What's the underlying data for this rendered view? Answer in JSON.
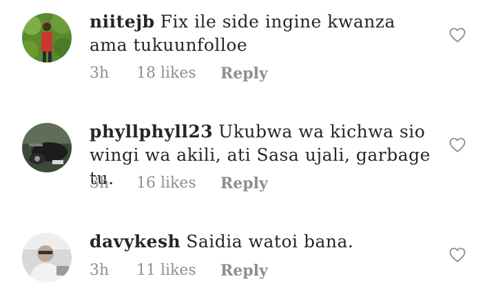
{
  "comments": [
    {
      "username": "niitejb",
      "text": "Fix ile side ingine  kwanza ama tukuunfolloe",
      "time": "3h",
      "likes": "18 likes",
      "reply": "Reply"
    },
    {
      "username": "phyllphyll23",
      "text": "Ukubwa wa kichwa sio wingi wa akili, ati Sasa ujali, garbage tu.",
      "time": "3h",
      "likes": "16 likes",
      "reply": "Reply"
    },
    {
      "username": "davykesh",
      "text": "Saidia watoi bana.",
      "time": "3h",
      "likes": "11 likes",
      "reply": "Reply"
    }
  ],
  "icons": {
    "like": "heart-outline-icon"
  },
  "colors": {
    "text": "#262626",
    "meta": "#8e8e8e"
  }
}
